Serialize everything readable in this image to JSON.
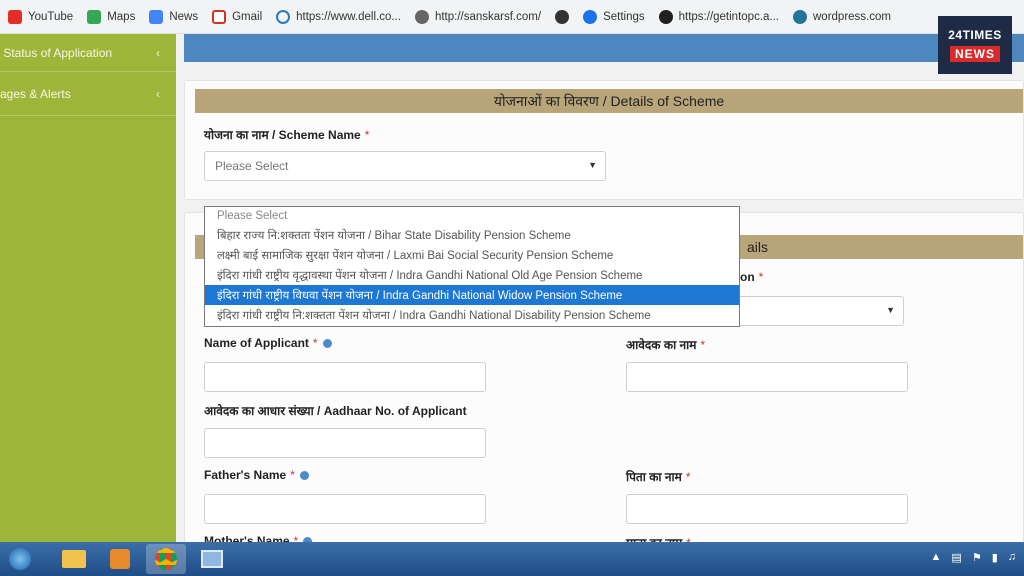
{
  "bookmarks": [
    {
      "label": "YouTube",
      "icon": "youtube-icon",
      "color": "#e52d27"
    },
    {
      "label": "Maps",
      "icon": "maps-icon",
      "color": "#34a853"
    },
    {
      "label": "News",
      "icon": "news-icon",
      "color": "#4285f4"
    },
    {
      "label": "Gmail",
      "icon": "gmail-icon",
      "color": "#d93025"
    },
    {
      "label": "https://www.dell.co...",
      "icon": "dell-icon",
      "color": "#2b7bbf"
    },
    {
      "label": "http://sanskarsf.com/",
      "icon": "globe-icon",
      "color": "#555555"
    },
    {
      "label": "",
      "icon": "globe-icon",
      "color": "#333333"
    },
    {
      "label": "Settings",
      "icon": "gear-icon",
      "color": "#1a73e8"
    },
    {
      "label": "https://getintopc.a...",
      "icon": "getintopc-icon",
      "color": "#202020"
    },
    {
      "label": "wordpress.com",
      "icon": "wordpress-icon",
      "color": "#21759b"
    }
  ],
  "sidebar": {
    "items": [
      {
        "label": "v Status of Application"
      },
      {
        "label": "sages & Alerts"
      }
    ]
  },
  "scheme_panel": {
    "title": "योजनाओं का विवरण / Details of Scheme",
    "scheme_label": "योजना का नाम / Scheme Name",
    "scheme_select_value": "Please Select"
  },
  "dropdown": {
    "options": [
      "Please Select",
      "बिहार राज्य नि:शक्तता पेंशन योजना / Bihar State Disability Pension Scheme",
      "लक्ष्मी बाई सामाजिक सुरक्षा पेंशन योजना / Laxmi Bai Social Security Pension Scheme",
      "इंदिरा गांधी राष्ट्रीय वृद्धावस्था पेंशन योजना / Indra Gandhi National Old Age Pension Scheme",
      "इंदिरा गांधी राष्ट्रीय विधवा पेंशन योजना / Indra Gandhi National Widow Pension Scheme",
      "इंदिरा गांधी राष्ट्रीय नि:शक्तता पेंशन योजना / Indra Gandhi National Disability Pension Scheme"
    ],
    "highlighted_index": 4
  },
  "applicant_panel": {
    "title_fragment": "ails",
    "field_fragment_label": "on",
    "labels": {
      "name_of_applicant": "Name of Applicant",
      "name_hindi": "आवेदक का नाम",
      "aadhaar": "आवेदक का आधार संख्या / Aadhaar No. of Applicant",
      "fathers_name": "Father's Name",
      "fathers_name_hindi": "पिता का नाम",
      "mothers_name": "Mother's Name",
      "mothers_name_hindi": "माता का नाम"
    }
  },
  "logo": {
    "line1": "24TIMES",
    "line2": "NEWS"
  },
  "required_mark": "*",
  "colors": {
    "sidebar": "#9fb539",
    "panel_header": "#b8a67a",
    "highlight": "#1e77d3",
    "topbar": "#4e87bf"
  }
}
